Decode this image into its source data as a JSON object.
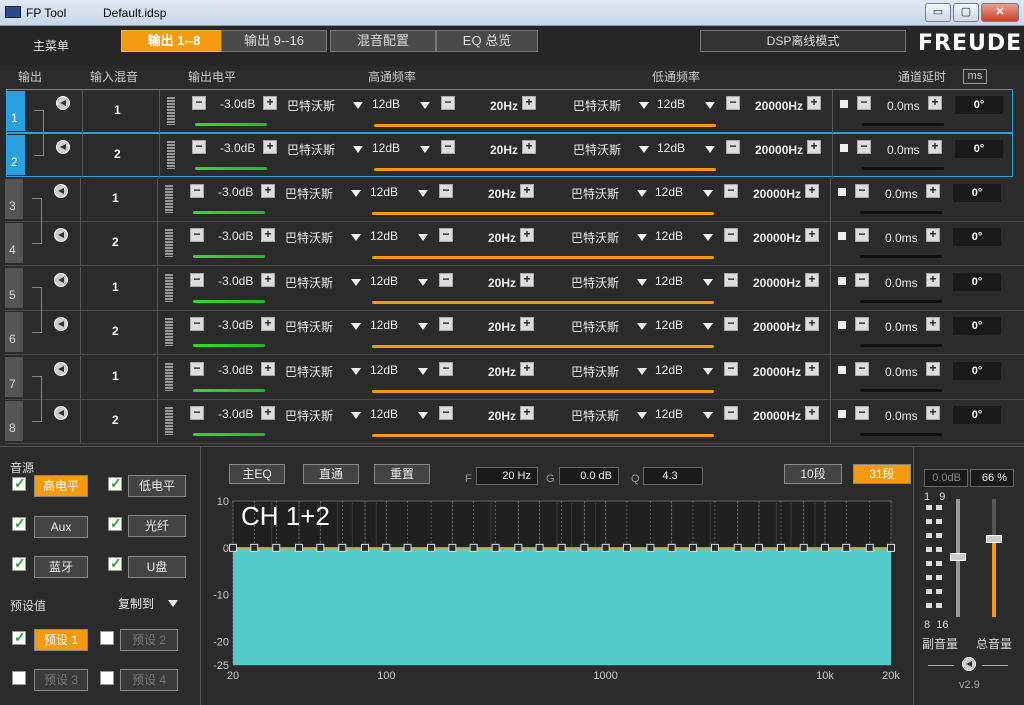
{
  "window": {
    "app_title": "FP Tool",
    "file_title": "Default.idsp",
    "minimize": "▭",
    "maximize": "▢",
    "close": "✕"
  },
  "nav": {
    "menu_label": "主菜单",
    "tabs": [
      "输出 1--8",
      "输出 9--16",
      "混音配置",
      "EQ 总览"
    ],
    "mode_button": "DSP离线模式",
    "brand": "FREUDE"
  },
  "columns": {
    "output": "输出",
    "input_mix": "输入混音",
    "output_level": "输出电平",
    "high_pass": "高通频率",
    "low_pass": "低通频率",
    "delay": "通道延时",
    "delay_unit": "ms"
  },
  "channels": [
    {
      "num": "1",
      "mix": "1",
      "level": "-3.0dB",
      "hp_type": "巴特沃斯",
      "hp_slope": "12dB",
      "hp_freq": "20Hz",
      "lp_type": "巴特沃斯",
      "lp_slope": "12dB",
      "lp_freq": "20000Hz",
      "delay": "0.0ms",
      "phase": "0°"
    },
    {
      "num": "2",
      "mix": "2",
      "level": "-3.0dB",
      "hp_type": "巴特沃斯",
      "hp_slope": "12dB",
      "hp_freq": "20Hz",
      "lp_type": "巴特沃斯",
      "lp_slope": "12dB",
      "lp_freq": "20000Hz",
      "delay": "0.0ms",
      "phase": "0°"
    },
    {
      "num": "3",
      "mix": "1",
      "level": "-3.0dB",
      "hp_type": "巴特沃斯",
      "hp_slope": "12dB",
      "hp_freq": "20Hz",
      "lp_type": "巴特沃斯",
      "lp_slope": "12dB",
      "lp_freq": "20000Hz",
      "delay": "0.0ms",
      "phase": "0°"
    },
    {
      "num": "4",
      "mix": "2",
      "level": "-3.0dB",
      "hp_type": "巴特沃斯",
      "hp_slope": "12dB",
      "hp_freq": "20Hz",
      "lp_type": "巴特沃斯",
      "lp_slope": "12dB",
      "lp_freq": "20000Hz",
      "delay": "0.0ms",
      "phase": "0°"
    },
    {
      "num": "5",
      "mix": "1",
      "level": "-3.0dB",
      "hp_type": "巴特沃斯",
      "hp_slope": "12dB",
      "hp_freq": "20Hz",
      "lp_type": "巴特沃斯",
      "lp_slope": "12dB",
      "lp_freq": "20000Hz",
      "delay": "0.0ms",
      "phase": "0°"
    },
    {
      "num": "6",
      "mix": "2",
      "level": "-3.0dB",
      "hp_type": "巴特沃斯",
      "hp_slope": "12dB",
      "hp_freq": "20Hz",
      "lp_type": "巴特沃斯",
      "lp_slope": "12dB",
      "lp_freq": "20000Hz",
      "delay": "0.0ms",
      "phase": "0°"
    },
    {
      "num": "7",
      "mix": "1",
      "level": "-3.0dB",
      "hp_type": "巴特沃斯",
      "hp_slope": "12dB",
      "hp_freq": "20Hz",
      "lp_type": "巴特沃斯",
      "lp_slope": "12dB",
      "lp_freq": "20000Hz",
      "delay": "0.0ms",
      "phase": "0°"
    },
    {
      "num": "8",
      "mix": "2",
      "level": "-3.0dB",
      "hp_type": "巴特沃斯",
      "hp_slope": "12dB",
      "hp_freq": "20Hz",
      "lp_type": "巴特沃斯",
      "lp_slope": "12dB",
      "lp_freq": "20000Hz",
      "delay": "0.0ms",
      "phase": "0°"
    }
  ],
  "source": {
    "label": "音源",
    "items": [
      "高电平",
      "低电平",
      "Aux",
      "光纤",
      "蓝牙",
      "U盘"
    ]
  },
  "presets": {
    "label": "预设值",
    "copy_to": "复制到",
    "items": [
      "预设 1",
      "预设 2",
      "预设 3",
      "预设 4"
    ]
  },
  "eq": {
    "buttons": [
      "主EQ",
      "直通",
      "重置"
    ],
    "f_label": "F",
    "f_value": "20 Hz",
    "g_label": "G",
    "g_value": "0.0 dB",
    "q_label": "Q",
    "q_value": "4.3",
    "band10": "10段",
    "band31": "31段",
    "channel_label": "CH 1+2",
    "y_ticks": [
      "10",
      "0",
      "-10",
      "-20",
      "-25"
    ],
    "x_ticks": [
      "20",
      "100",
      "1000",
      "10k",
      "20k"
    ]
  },
  "volume": {
    "db_value": "0.0dB",
    "percent": "66 %",
    "range_top": "1   9",
    "range_bottom": "8  16",
    "sub_label": "副音量",
    "master_label": "总音量",
    "version": "v2.9",
    "master_level": 0.66
  },
  "chart_data": {
    "type": "line",
    "title": "CH 1+2",
    "xlabel": "",
    "ylabel": "",
    "x_scale": "log",
    "xlim": [
      20,
      20000
    ],
    "ylim": [
      -25,
      10
    ],
    "x": [
      20,
      25,
      31.5,
      40,
      50,
      63,
      80,
      100,
      125,
      160,
      200,
      250,
      315,
      400,
      500,
      630,
      800,
      1000,
      1250,
      1600,
      2000,
      2500,
      3150,
      4000,
      5000,
      6300,
      8000,
      10000,
      12500,
      16000,
      20000
    ],
    "values": [
      0,
      0,
      0,
      0,
      0,
      0,
      0,
      0,
      0,
      0,
      0,
      0,
      0,
      0,
      0,
      0,
      0,
      0,
      0,
      0,
      0,
      0,
      0,
      0,
      0,
      0,
      0,
      0,
      0,
      0,
      0
    ],
    "fill_color": "#55cccc"
  }
}
